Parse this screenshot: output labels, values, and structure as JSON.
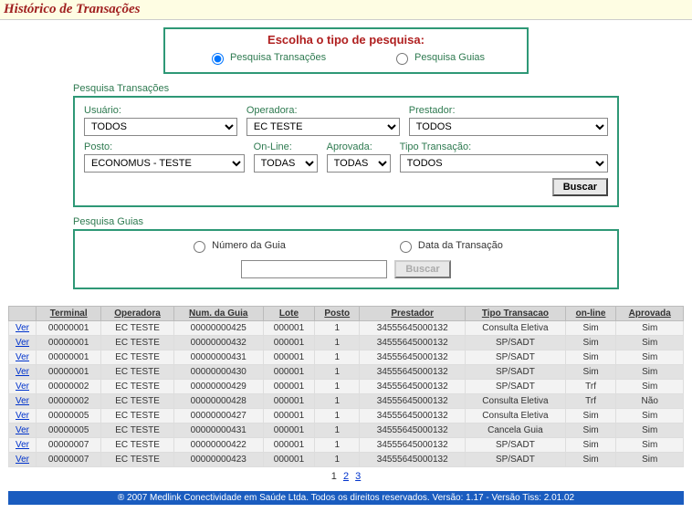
{
  "title": "Histórico de Transações",
  "choice": {
    "title": "Escolha o tipo de pesquisa:",
    "opt_transacoes": "Pesquisa Transações",
    "opt_guias": "Pesquisa Guias"
  },
  "transacoes": {
    "legend": "Pesquisa Transações",
    "usuario_label": "Usuário:",
    "usuario_value": "TODOS",
    "operadora_label": "Operadora:",
    "operadora_value": "EC TESTE",
    "prestador_label": "Prestador:",
    "prestador_value": "TODOS",
    "posto_label": "Posto:",
    "posto_value": "ECONOMUS - TESTE",
    "online_label": "On-Line:",
    "online_value": "TODAS",
    "aprovada_label": "Aprovada:",
    "aprovada_value": "TODAS",
    "tipo_label": "Tipo Transação:",
    "tipo_value": "TODOS",
    "buscar": "Buscar"
  },
  "guias": {
    "legend": "Pesquisa Guias",
    "opt_numero": "Número da Guia",
    "opt_data": "Data da Transação",
    "input_value": "",
    "buscar": "Buscar"
  },
  "table": {
    "headers": {
      "ver": "",
      "terminal": "Terminal",
      "operadora": "Operadora",
      "num_guia": "Num. da Guia",
      "lote": "Lote",
      "posto": "Posto",
      "prestador": "Prestador",
      "tipo": "Tipo Transacao",
      "online": "on-line",
      "aprovada": "Aprovada"
    },
    "ver_label": "Ver",
    "rows": [
      {
        "terminal": "00000001",
        "operadora": "EC TESTE",
        "num_guia": "00000000425",
        "lote": "000001",
        "posto": "1",
        "prestador": "34555645000132",
        "tipo": "Consulta Eletiva",
        "online": "Sim",
        "aprovada": "Sim"
      },
      {
        "terminal": "00000001",
        "operadora": "EC TESTE",
        "num_guia": "00000000432",
        "lote": "000001",
        "posto": "1",
        "prestador": "34555645000132",
        "tipo": "SP/SADT",
        "online": "Sim",
        "aprovada": "Sim"
      },
      {
        "terminal": "00000001",
        "operadora": "EC TESTE",
        "num_guia": "00000000431",
        "lote": "000001",
        "posto": "1",
        "prestador": "34555645000132",
        "tipo": "SP/SADT",
        "online": "Sim",
        "aprovada": "Sim"
      },
      {
        "terminal": "00000001",
        "operadora": "EC TESTE",
        "num_guia": "00000000430",
        "lote": "000001",
        "posto": "1",
        "prestador": "34555645000132",
        "tipo": "SP/SADT",
        "online": "Sim",
        "aprovada": "Sim"
      },
      {
        "terminal": "00000002",
        "operadora": "EC TESTE",
        "num_guia": "00000000429",
        "lote": "000001",
        "posto": "1",
        "prestador": "34555645000132",
        "tipo": "SP/SADT",
        "online": "Trf",
        "aprovada": "Sim"
      },
      {
        "terminal": "00000002",
        "operadora": "EC TESTE",
        "num_guia": "00000000428",
        "lote": "000001",
        "posto": "1",
        "prestador": "34555645000132",
        "tipo": "Consulta Eletiva",
        "online": "Trf",
        "aprovada": "Não"
      },
      {
        "terminal": "00000005",
        "operadora": "EC TESTE",
        "num_guia": "00000000427",
        "lote": "000001",
        "posto": "1",
        "prestador": "34555645000132",
        "tipo": "Consulta Eletiva",
        "online": "Sim",
        "aprovada": "Sim"
      },
      {
        "terminal": "00000005",
        "operadora": "EC TESTE",
        "num_guia": "00000000431",
        "lote": "000001",
        "posto": "1",
        "prestador": "34555645000132",
        "tipo": "Cancela Guia",
        "online": "Sim",
        "aprovada": "Sim"
      },
      {
        "terminal": "00000007",
        "operadora": "EC TESTE",
        "num_guia": "00000000422",
        "lote": "000001",
        "posto": "1",
        "prestador": "34555645000132",
        "tipo": "SP/SADT",
        "online": "Sim",
        "aprovada": "Sim"
      },
      {
        "terminal": "00000007",
        "operadora": "EC TESTE",
        "num_guia": "00000000423",
        "lote": "000001",
        "posto": "1",
        "prestador": "34555645000132",
        "tipo": "SP/SADT",
        "online": "Sim",
        "aprovada": "Sim"
      }
    ]
  },
  "pager": {
    "p1": "1",
    "p2": "2",
    "p3": "3"
  },
  "footer": "® 2007  Medlink Conectividade em Saúde Ltda.    Todos os direitos reservados.    Versão: 1.17 - Versão Tiss: 2.01.02"
}
